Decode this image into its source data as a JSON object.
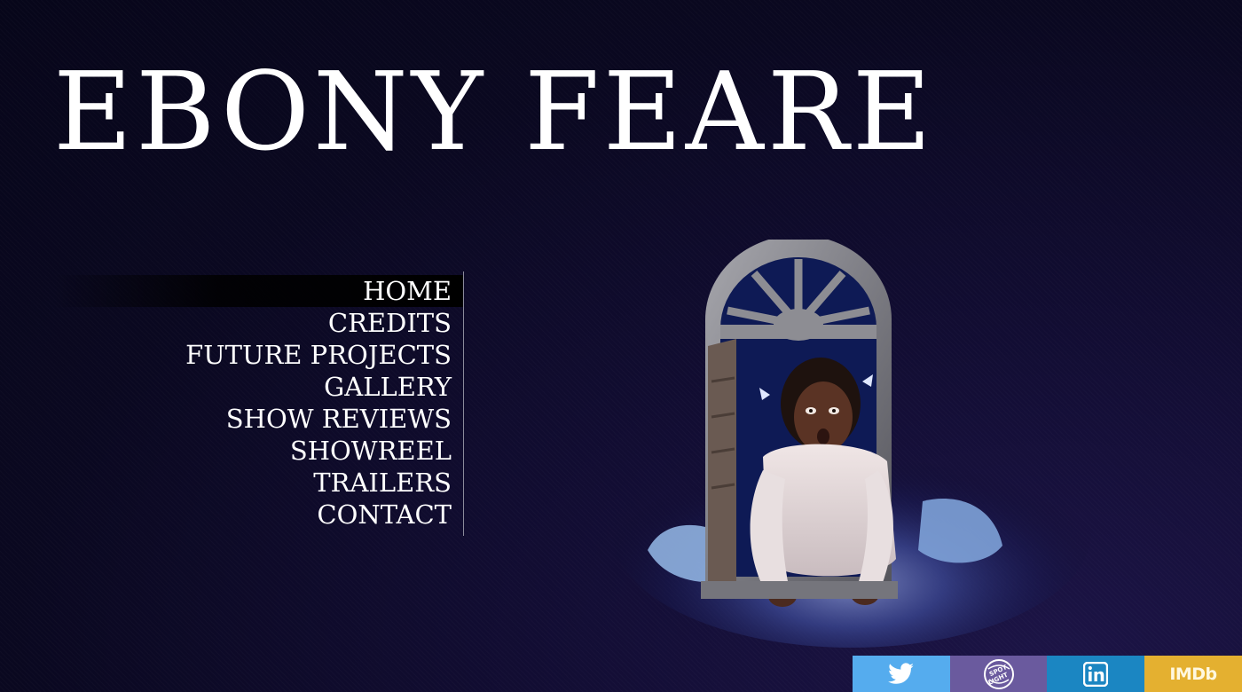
{
  "site": {
    "title": "EBONY FEARE"
  },
  "nav": {
    "items": [
      {
        "label": "HOME",
        "active": true
      },
      {
        "label": "CREDITS"
      },
      {
        "label": "FUTURE PROJECTS"
      },
      {
        "label": "GALLERY"
      },
      {
        "label": "SHOW REVIEWS"
      },
      {
        "label": "SHOWREEL"
      },
      {
        "label": "TRAILERS"
      },
      {
        "label": "CONTACT"
      }
    ]
  },
  "hero": {
    "icon": "stage-photo-actress-in-window"
  },
  "social": {
    "items": [
      {
        "name": "twitter",
        "icon": "twitter-bird-icon",
        "color": "#55acee"
      },
      {
        "name": "spotlight",
        "icon": "spotlight-logo-icon",
        "color": "#6a5a9e",
        "logo_text": "SPOTLIGHT"
      },
      {
        "name": "linkedin",
        "icon": "linkedin-icon",
        "color": "#1b86c2",
        "logo_text": "in"
      },
      {
        "name": "imdb",
        "icon": "imdb-logo-icon",
        "color": "#e4b030",
        "label": "IMDb"
      }
    ]
  }
}
